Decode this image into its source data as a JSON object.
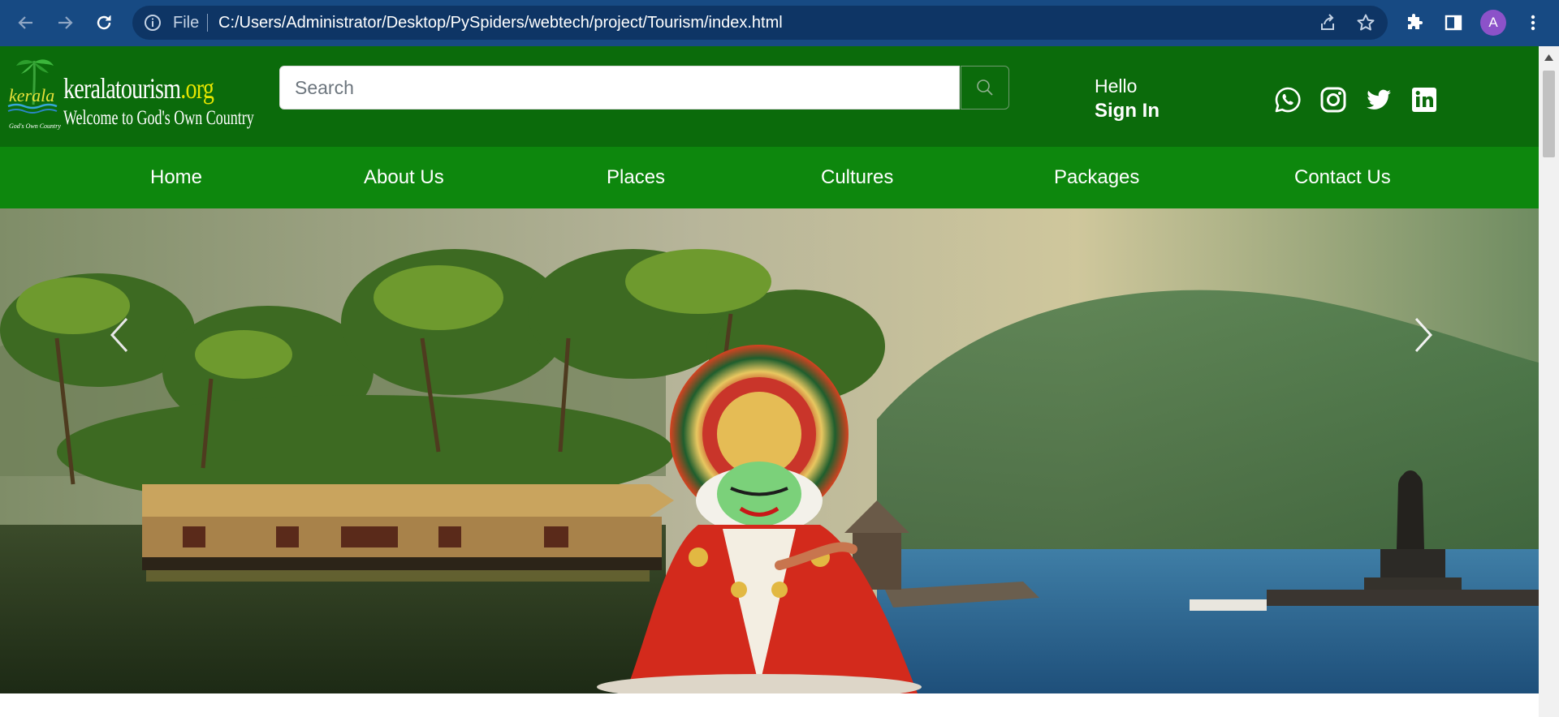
{
  "browser": {
    "nav_icons": [
      "back-arrow-icon",
      "forward-arrow-icon",
      "reload-icon"
    ],
    "address_bar": {
      "scheme_label": "File",
      "url": "C:/Users/Administrator/Desktop/PySpiders/webtech/project/Tourism/index.html"
    },
    "right_icons": [
      "share-icon",
      "bookmark-star-icon",
      "extensions-puzzle-icon",
      "side-panel-icon",
      "kebab-menu-icon"
    ],
    "profile_initial": "A",
    "colors": {
      "frame": "#174a83",
      "omnibox": "#0e3565",
      "avatar": "#8c52c9"
    }
  },
  "site": {
    "logo": {
      "name": "keralatourism",
      "tld": ".org",
      "tagline": "Welcome to God's Own Country",
      "emblem_word": "kerala",
      "emblem_subtitle": "God's Own Country"
    },
    "search": {
      "placeholder": "Search"
    },
    "account": {
      "greeting": "Hello",
      "action": "Sign In"
    },
    "social": [
      "whatsapp-icon",
      "instagram-icon",
      "twitter-icon",
      "linkedin-icon"
    ],
    "nav": [
      "Home",
      "About Us",
      "Places",
      "Cultures",
      "Packages",
      "Contact Us"
    ],
    "colors": {
      "header": "#0b6b0b",
      "nav": "#0d870d",
      "logo_tld": "#e6e600"
    }
  },
  "hero": {
    "controls": [
      "carousel-prev-icon",
      "carousel-next-icon"
    ]
  }
}
